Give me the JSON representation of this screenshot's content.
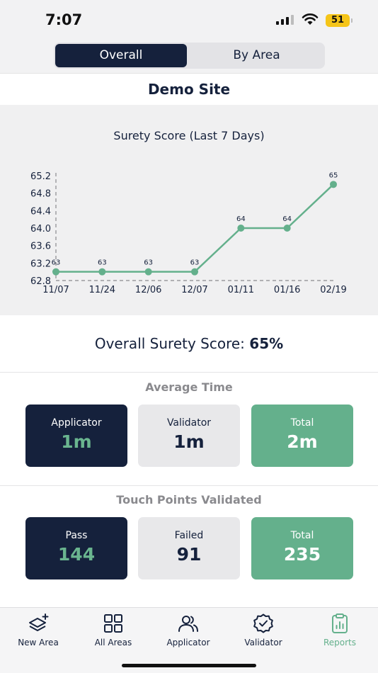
{
  "status_bar": {
    "time": "7:07",
    "battery": "51"
  },
  "segmented": {
    "options": [
      "Overall",
      "By Area"
    ],
    "selected": "Overall"
  },
  "site_title": "Demo Site",
  "chart_data": {
    "type": "line",
    "title": "Surety Score (Last 7 Days)",
    "categories": [
      "11/07",
      "11/24",
      "12/06",
      "12/07",
      "01/11",
      "01/16",
      "02/19"
    ],
    "values": [
      63,
      63,
      63,
      63,
      64,
      64,
      65
    ],
    "data_labels": [
      "63",
      "63",
      "63",
      "63",
      "64",
      "64",
      "65"
    ],
    "y_ticks": [
      "65.2",
      "64.8",
      "64.4",
      "64.0",
      "63.6",
      "63.2",
      "62.8"
    ],
    "ylim": [
      62.8,
      65.2
    ],
    "color": "#64b08c"
  },
  "overall_score": {
    "label": "Overall Surety Score:",
    "value": "65%"
  },
  "average_time": {
    "title": "Average Time",
    "cards": [
      {
        "label": "Applicator",
        "value": "1m"
      },
      {
        "label": "Validator",
        "value": "1m"
      },
      {
        "label": "Total",
        "value": "2m"
      }
    ]
  },
  "touch_points": {
    "title": "Touch Points Validated",
    "cards": [
      {
        "label": "Pass",
        "value": "144"
      },
      {
        "label": "Failed",
        "value": "91"
      },
      {
        "label": "Total",
        "value": "235"
      }
    ]
  },
  "tab_bar": {
    "items": [
      {
        "label": "New Area",
        "icon": "layers-plus-icon"
      },
      {
        "label": "All Areas",
        "icon": "grid-icon"
      },
      {
        "label": "Applicator",
        "icon": "users-icon"
      },
      {
        "label": "Validator",
        "icon": "badge-check-icon"
      },
      {
        "label": "Reports",
        "icon": "clipboard-chart-icon"
      }
    ],
    "active": "Reports"
  },
  "colors": {
    "navy": "#15213c",
    "green": "#64b08c",
    "battery": "#f5c518"
  }
}
